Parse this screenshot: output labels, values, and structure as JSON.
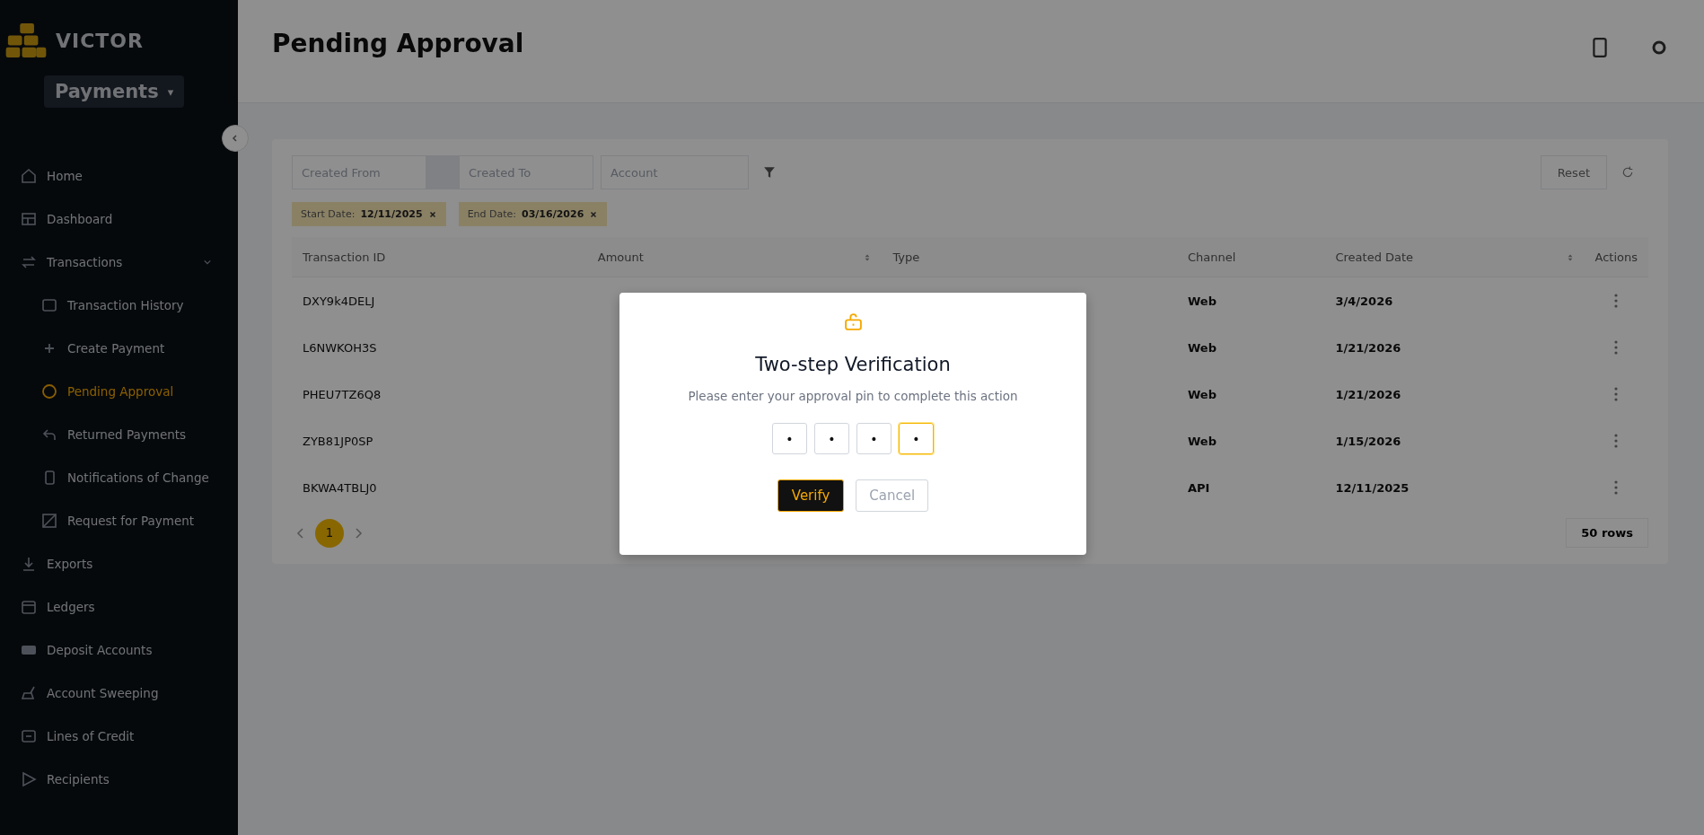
{
  "brand": {
    "name": "VICTOR"
  },
  "module_switcher": {
    "label": "Payments",
    "caret": "▾"
  },
  "sidebar": {
    "items": [
      {
        "label": "Home",
        "selected": false
      },
      {
        "label": "Dashboard",
        "selected": false
      },
      {
        "label": "Transactions",
        "selected": false,
        "expanded": true,
        "children": [
          {
            "label": "Transaction History",
            "selected": false
          },
          {
            "label": "Create Payment",
            "selected": false
          },
          {
            "label": "Pending Approval",
            "selected": true
          },
          {
            "label": "Returned Payments",
            "selected": false
          },
          {
            "label": "Notifications of Change",
            "selected": false
          },
          {
            "label": "Request for Payment",
            "selected": false
          }
        ]
      },
      {
        "label": "Exports",
        "selected": false
      },
      {
        "label": "Ledgers",
        "selected": false
      },
      {
        "label": "Deposit Accounts",
        "selected": false
      },
      {
        "label": "Account Sweeping",
        "selected": false
      },
      {
        "label": "Lines of Credit",
        "selected": false
      },
      {
        "label": "Recipients",
        "selected": false
      }
    ]
  },
  "page": {
    "title": "Pending Approval"
  },
  "filters": {
    "created_from": {
      "placeholder": "Created From"
    },
    "created_to": {
      "placeholder": "Created To"
    },
    "account": {
      "placeholder": "Account"
    },
    "reset": "Reset"
  },
  "chips": [
    {
      "label": "Start Date:",
      "value": "12/11/2025"
    },
    {
      "label": "End Date:",
      "value": "03/16/2026"
    }
  ],
  "table": {
    "columns": [
      {
        "label": "Transaction ID",
        "sortable": false
      },
      {
        "label": "Amount",
        "sortable": true
      },
      {
        "label": "Type",
        "sortable": false
      },
      {
        "label": "Channel",
        "sortable": false
      },
      {
        "label": "Created Date",
        "sortable": true
      },
      {
        "label": "Actions",
        "sortable": false
      }
    ],
    "rows": [
      {
        "id": "DXY9k4DELJ",
        "channel": "Web",
        "date": "3/4/2026"
      },
      {
        "id": "L6NWKOH3S",
        "channel": "Web",
        "date": "1/21/2026"
      },
      {
        "id": "PHEU7TZ6Q8",
        "channel": "Web",
        "date": "1/21/2026"
      },
      {
        "id": "ZYB81JP0SP",
        "channel": "Web",
        "date": "1/15/2026"
      },
      {
        "id": "BKWA4TBLJ0",
        "channel": "API",
        "date": "12/11/2025"
      }
    ]
  },
  "pagination": {
    "pages": [
      {
        "label": "1",
        "selected": true
      }
    ],
    "rows_per_page": "50 rows"
  },
  "dialog": {
    "title": "Two-step Verification",
    "message": "Please enter your approval pin to complete this action",
    "pins": [
      {
        "value": "•",
        "focused": false
      },
      {
        "value": "•",
        "focused": false
      },
      {
        "value": "•",
        "focused": false
      },
      {
        "value": "•",
        "focused": true
      }
    ],
    "buttons": [
      {
        "label": "Verify",
        "kind": "primary"
      },
      {
        "label": "Cancel",
        "kind": "secondary"
      }
    ]
  }
}
